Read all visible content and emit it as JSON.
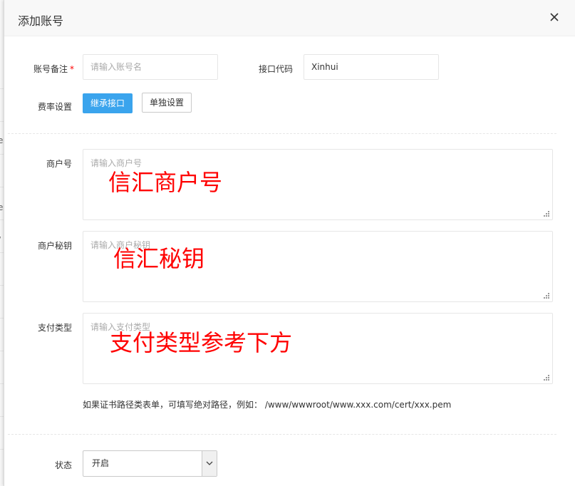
{
  "dialog": {
    "title": "添加账号",
    "close_icon": "close-icon"
  },
  "form": {
    "account_note": {
      "label": "账号备注",
      "required_mark": "*",
      "placeholder": "请输入账号名",
      "value": ""
    },
    "interface_code": {
      "label": "接口代码",
      "value": "Xinhui"
    },
    "rate_setting": {
      "label": "费率设置",
      "inherit_button": "继承接口",
      "separate_button": "单独设置"
    },
    "merchant_no": {
      "label": "商户号",
      "placeholder": "请输入商户号",
      "annotation": "信汇商户号"
    },
    "merchant_key": {
      "label": "商户秘钥",
      "placeholder": "请输入商户秘钥",
      "annotation": "信汇秘钥"
    },
    "pay_type": {
      "label": "支付类型",
      "placeholder": "请输入支付类型",
      "annotation": "支付类型参考下方"
    },
    "help_text": "如果证书路径类表单，可填写绝对路径，例如： /www/wwwroot/www.xxx.com/cert/xxx.pem",
    "status": {
      "label": "状态",
      "selected": "开启",
      "arrow_icon": "chevron-down-icon"
    }
  },
  "background_edge": {
    "chars": [
      "e",
      "e",
      "/"
    ]
  },
  "colors": {
    "primary_button": "#3aa4ed",
    "annotation_red": "#ff0000",
    "required_red": "#ff0000",
    "header_bg": "#f8f8f8"
  }
}
